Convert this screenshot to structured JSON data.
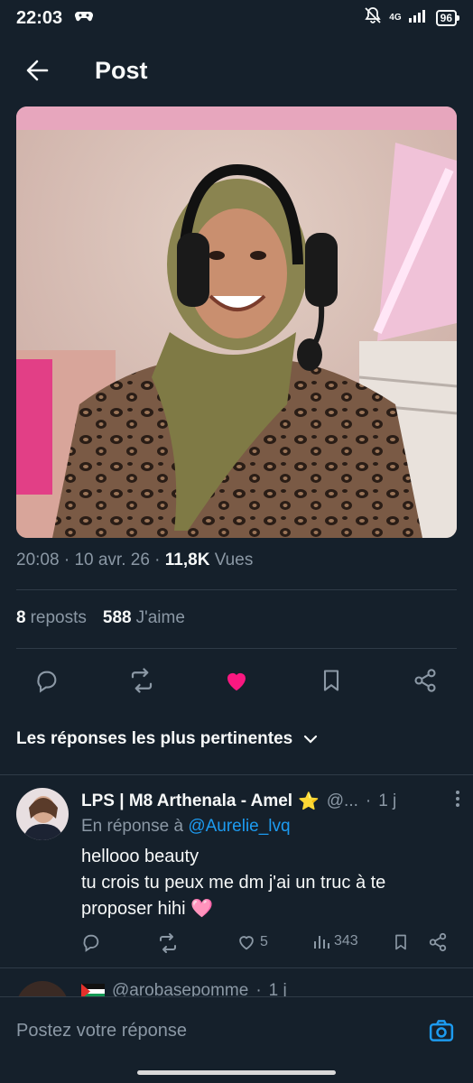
{
  "status_bar": {
    "time": "22:03",
    "network": "4G",
    "battery": "96"
  },
  "header": {
    "title": "Post"
  },
  "post": {
    "time": "20:08",
    "date": "10 avr. 26",
    "views_count": "11,8K",
    "views_label": "Vues",
    "reposts_count": "8",
    "reposts_label": "reposts",
    "likes_count": "588",
    "likes_label": "J'aime",
    "liked": true
  },
  "sort": {
    "label": "Les réponses les plus pertinentes"
  },
  "reply": {
    "name": "LPS | M8 Arthenala - Amel",
    "star": "⭐",
    "handle": "@...",
    "age": "1 j",
    "replying_prefix": "En réponse à",
    "replying_to": "@Aurelie_lvq",
    "line1": "hellooo beauty",
    "line2": "tu crois tu peux me dm j'ai un truc à te proposer hihi 🩷",
    "likes": "5",
    "views": "343"
  },
  "next_reply": {
    "handle": "@arobasepomme",
    "age": "1 j"
  },
  "composer": {
    "placeholder": "Postez votre réponse"
  },
  "colors": {
    "background": "#15202b",
    "accent": "#1d9bf0",
    "like": "#f91880",
    "muted": "#8b98a5"
  }
}
